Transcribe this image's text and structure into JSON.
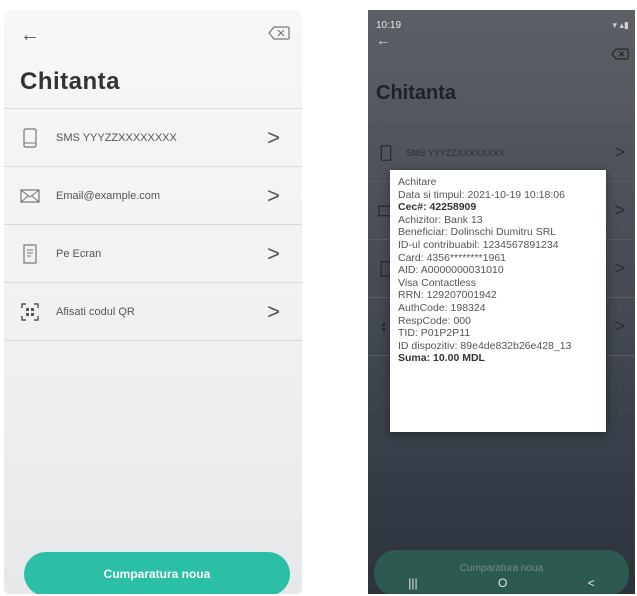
{
  "left": {
    "back_icon": "arrow-left-icon",
    "delete_icon": "backspace-icon",
    "title": "Chitanta",
    "options": [
      {
        "icon": "phone-icon",
        "label": "SMS YYYZZXXXXXXXX"
      },
      {
        "icon": "mail-icon",
        "label": "Email@example.com"
      },
      {
        "icon": "screen-icon",
        "label": "Pe Ecran"
      },
      {
        "icon": "qr-icon",
        "label": "Afisati codul QR"
      }
    ],
    "new_purchase": "Cumparatura noua"
  },
  "right": {
    "time": "10:19",
    "title": "Chitanta",
    "options": [
      {
        "icon": "phone-icon",
        "label": "SMS YYYZZXXXXXXXX"
      },
      {
        "icon": "mail-icon",
        "label": ""
      },
      {
        "icon": "screen-icon",
        "label": ""
      },
      {
        "icon": "qr-icon",
        "label": ""
      }
    ],
    "new_purchase": "Cumparatura noua",
    "nav": [
      "|||",
      "O",
      "<"
    ]
  },
  "receipt": {
    "lines": [
      {
        "text": "Achitare",
        "bold": false
      },
      {
        "text": "Data si timpul: 2021-10-19 10:18:06",
        "bold": false
      },
      {
        "text": "Cec#: 42258909",
        "bold": true
      },
      {
        "text": "Achizitor: Bank 13",
        "bold": false
      },
      {
        "text": "Beneficiar: Dolinschi Dumitru SRL",
        "bold": false
      },
      {
        "text": "ID-ul contribuabil: 1234567891234",
        "bold": false
      },
      {
        "text": "Card: 4356********1961",
        "bold": false
      },
      {
        "text": "AID: A0000000031010",
        "bold": false
      },
      {
        "text": "Visa Contactless",
        "bold": false
      },
      {
        "text": "RRN: 129207001942",
        "bold": false
      },
      {
        "text": "AuthCode: 198324",
        "bold": false
      },
      {
        "text": "RespCode: 000",
        "bold": false
      },
      {
        "text": "TID: P01P2P11",
        "bold": false
      },
      {
        "text": "ID dispozitiv: 89e4de832b26e428_13",
        "bold": false
      },
      {
        "text": "Suma: 10.00 MDL",
        "bold": true
      }
    ]
  },
  "colors": {
    "accent": "#2bbfa6"
  }
}
